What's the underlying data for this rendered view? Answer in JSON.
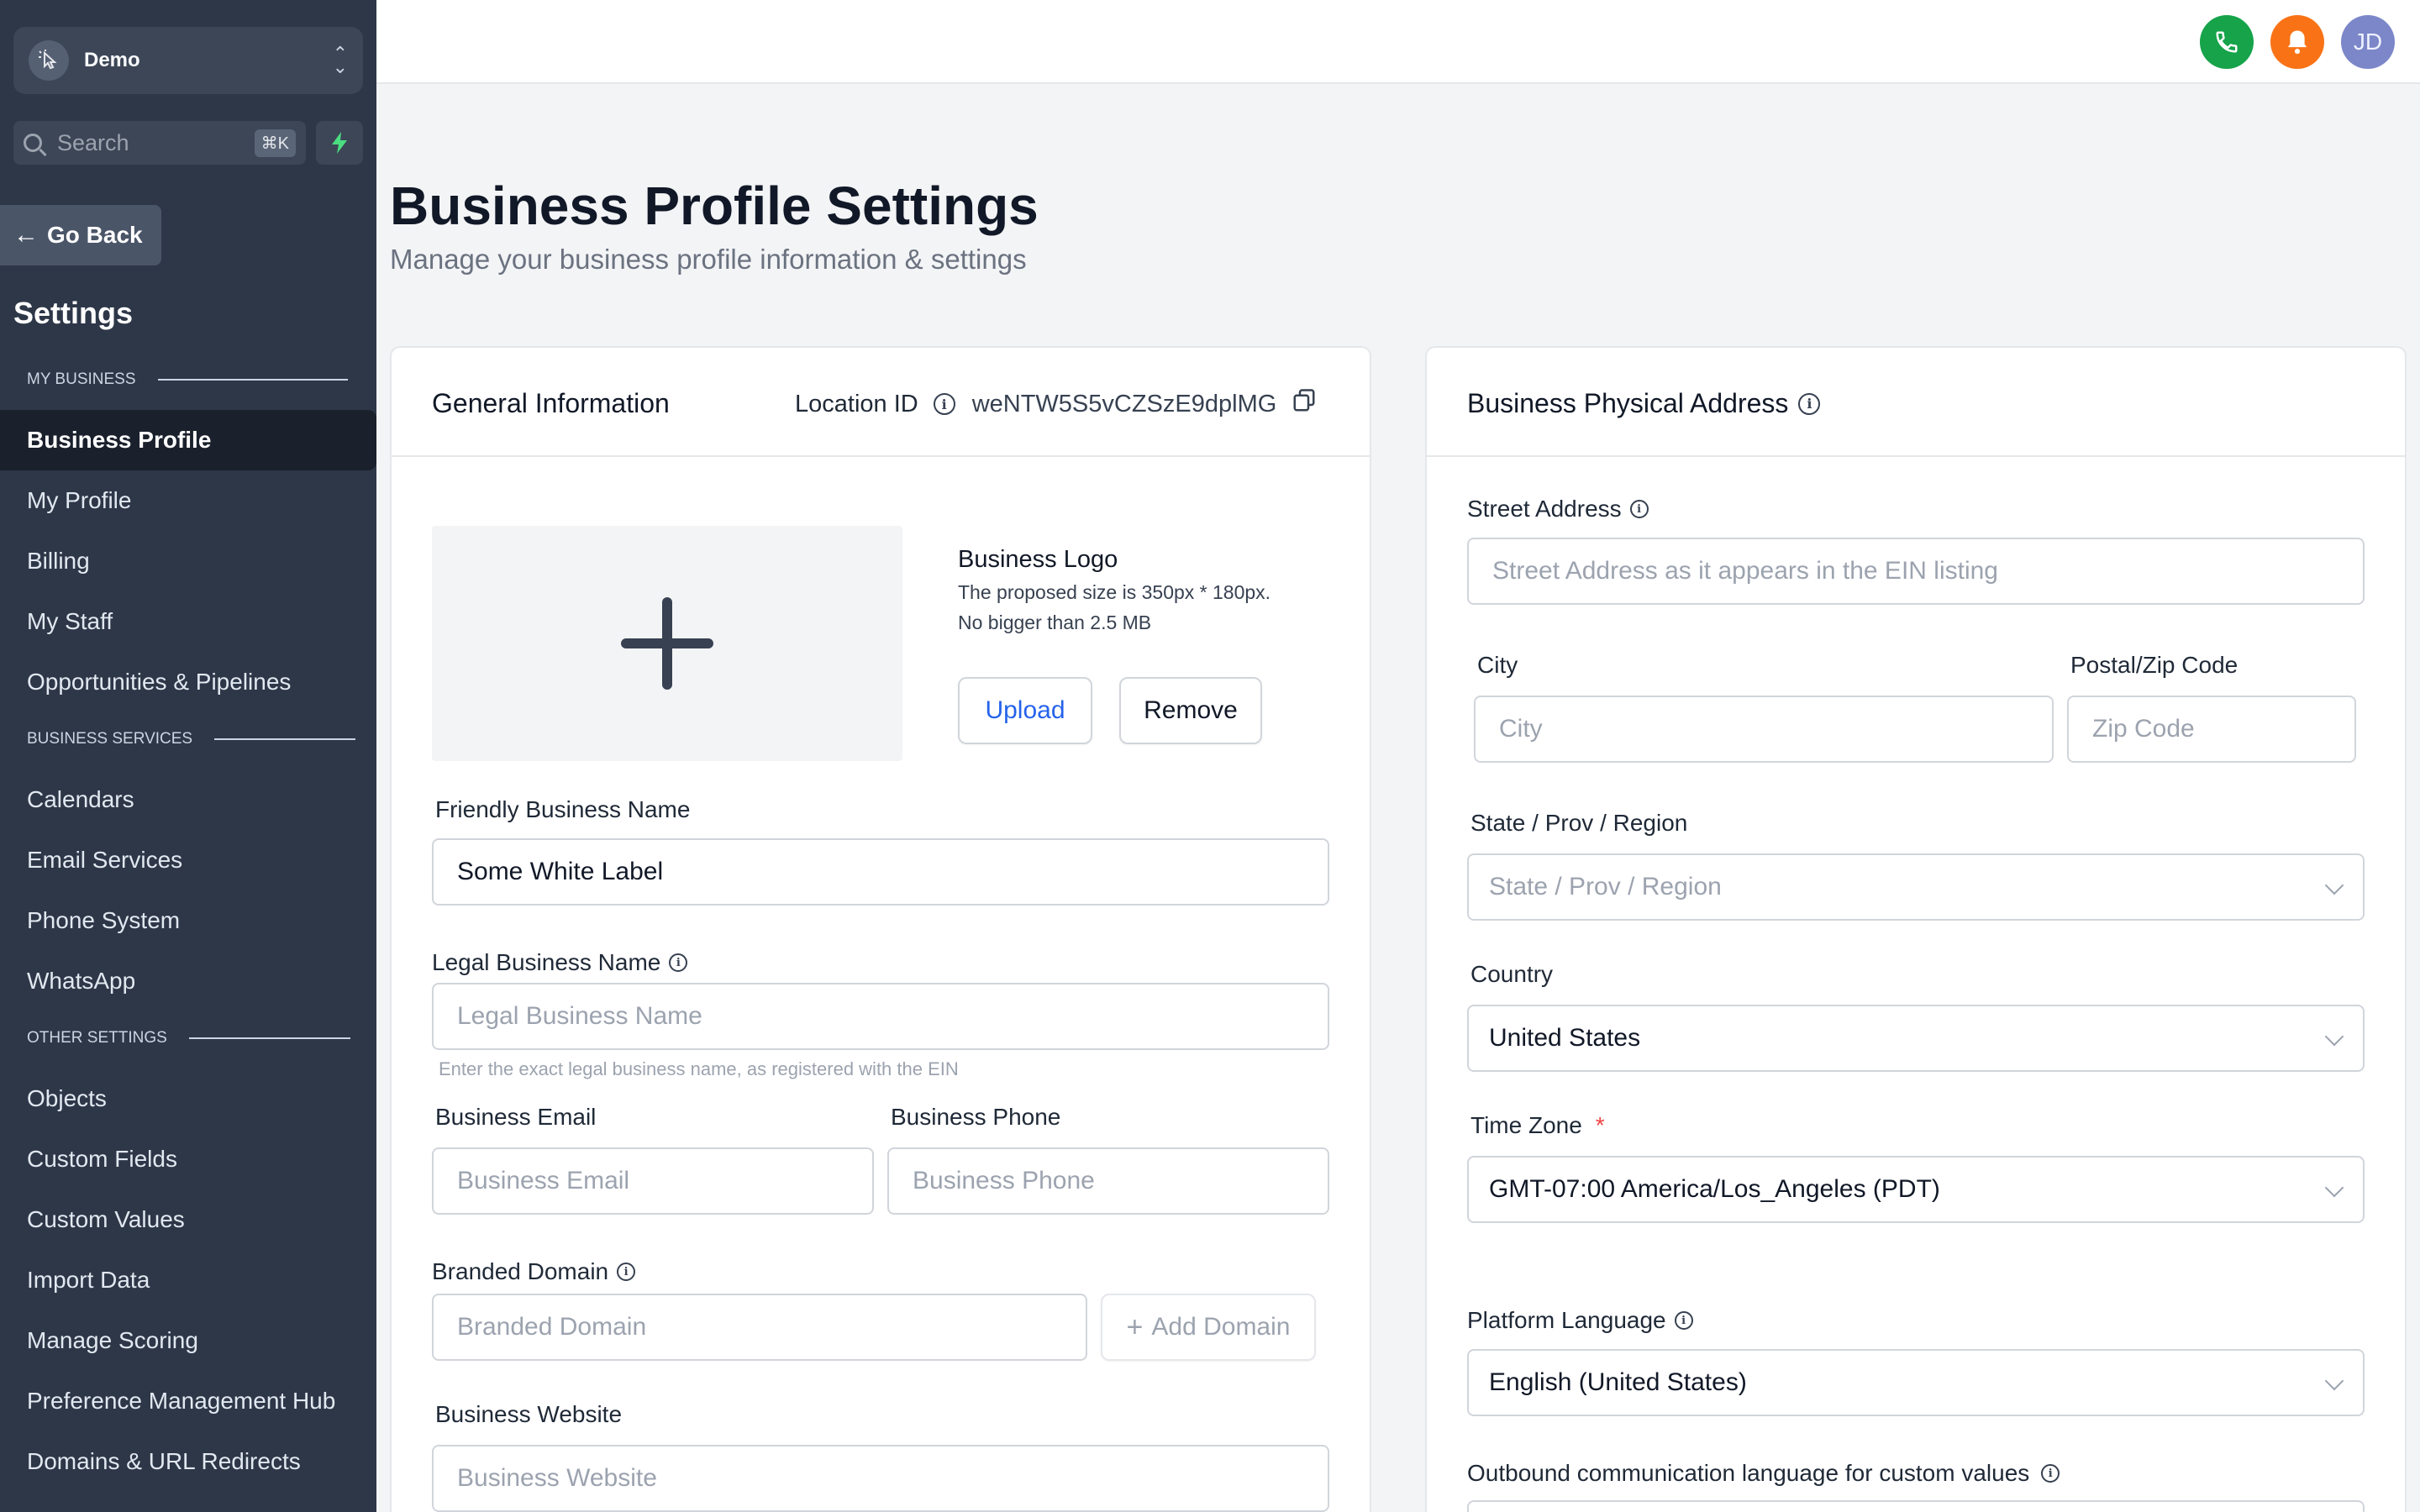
{
  "sidebar": {
    "account_name": "Demo",
    "search_placeholder": "Search",
    "search_shortcut": "⌘K",
    "go_back": "Go Back",
    "title": "Settings",
    "sections": {
      "my_business": "MY BUSINESS",
      "business_services": "BUSINESS SERVICES",
      "other_settings": "OTHER SETTINGS"
    },
    "items": [
      {
        "label": "Business Profile",
        "active": true
      },
      {
        "label": "My Profile"
      },
      {
        "label": "Billing"
      },
      {
        "label": "My Staff"
      },
      {
        "label": "Opportunities & Pipelines"
      },
      {
        "label": "Calendars"
      },
      {
        "label": "Email Services"
      },
      {
        "label": "Phone System"
      },
      {
        "label": "WhatsApp"
      },
      {
        "label": "Objects"
      },
      {
        "label": "Custom Fields"
      },
      {
        "label": "Custom Values"
      },
      {
        "label": "Import Data"
      },
      {
        "label": "Manage Scoring"
      },
      {
        "label": "Preference Management Hub"
      },
      {
        "label": "Domains & URL Redirects"
      }
    ]
  },
  "topbar": {
    "phone_icon": "phone-icon",
    "bell_icon": "bell-icon",
    "avatar_initials": "JD",
    "colors": {
      "phone": "#16a34a",
      "bell": "#f97316",
      "avatar": "#7c87c9"
    }
  },
  "page": {
    "title": "Business Profile Settings",
    "subtitle": "Manage your business profile information & settings"
  },
  "general": {
    "title": "General Information",
    "location_label": "Location ID",
    "location_id": "weNTW5S5vCZSzE9dplMG",
    "logo_title": "Business Logo",
    "logo_size": "The proposed size is 350px * 180px.",
    "logo_limit": "No bigger than 2.5 MB",
    "upload": "Upload",
    "remove": "Remove",
    "friendly_name_label": "Friendly Business Name",
    "friendly_name_value": "Some White Label",
    "legal_name_label": "Legal Business Name",
    "legal_name_placeholder": "Legal Business Name",
    "legal_name_hint": "Enter the exact legal business name, as registered with the EIN",
    "email_label": "Business Email",
    "email_placeholder": "Business Email",
    "phone_label": "Business Phone",
    "phone_placeholder": "Business Phone",
    "domain_label": "Branded Domain",
    "domain_placeholder": "Branded Domain",
    "add_domain": "Add Domain",
    "website_label": "Business Website",
    "website_placeholder": "Business Website"
  },
  "address": {
    "title": "Business Physical Address",
    "street_label": "Street Address",
    "street_placeholder": "Street Address as it appears in the EIN listing",
    "city_label": "City",
    "city_placeholder": "City",
    "zip_label": "Postal/Zip Code",
    "zip_placeholder": "Zip Code",
    "state_label": "State / Prov / Region",
    "state_placeholder": "State / Prov / Region",
    "country_label": "Country",
    "country_value": "United States",
    "tz_label": "Time Zone",
    "tz_required": "*",
    "tz_value": "GMT-07:00 America/Los_Angeles (PDT)",
    "lang_label": "Platform Language",
    "lang_value": "English (United States)",
    "outbound_label": "Outbound communication language for custom values"
  }
}
